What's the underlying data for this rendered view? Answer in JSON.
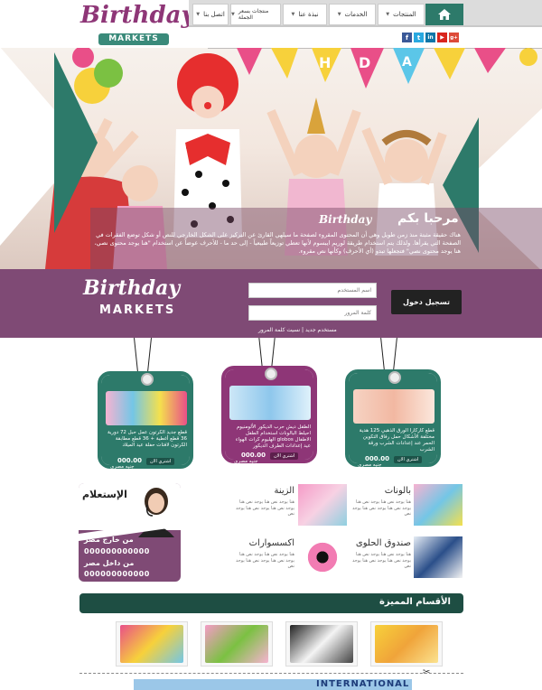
{
  "header": {
    "logo_line1": "Birthday",
    "logo_line2": "MARKETS"
  },
  "nav": {
    "items": [
      "المنتجات",
      "الخدمات",
      "نبذة عنا",
      "منتجات بسعر الجملة",
      "اتصل بنا"
    ]
  },
  "social": [
    "f",
    "t",
    "in",
    "▶",
    "g+"
  ],
  "hero": {
    "welcome_title": "مرحبا بكم",
    "welcome_logo": "Birthday",
    "welcome_text": "هناك حقيقة مثبتة منذ زمن طويل وهي أن المحتوى المقروء لصفحة ما سيلهي القارئ عن التركيز على الشكل الخارجي للنص أو شكل توضع الفقرات في الصفحة التي يقرأها. ولذلك يتم استخدام طريقة لوريم ايبسوم لأنها تعطي توزيعاً طبيعياً - إلى حد ما - للأحرف عوضاً عن استخدام \"هنا يوجد محتوى نصي، هنا يوجد محتوى نصي\" فتجعلها تبدو (أي الأحرف) وكأنها نص مقروء."
  },
  "login": {
    "logo_line1": "Birthday",
    "logo_line2": "MARKETS",
    "username_placeholder": "اسم المستخدم",
    "password_placeholder": "كلمة المرور",
    "button": "تسجيل دخول",
    "links": "مستخدم جديد | نسيت كلمة المرور"
  },
  "tags": [
    {
      "desc": "قطع كاركارا الورق الذهبي 125 هدية مختلفة الأشكال حمل رفاق التكوين الحمر عند إعدادات الشرب ورقة الشرب",
      "price": "000.00",
      "currency": "جنيه مصري",
      "button": "اشتري الان",
      "color": "#2d7a6a"
    },
    {
      "desc": "الطقل ديش حرب الديكور الألومنيوم احيلط البالونات استخدام الطفل الاطفال globos الهليوم كرات الهواء عيد إعدادات الطرف الديكور",
      "price": "000.00",
      "currency": "جنيه مصري",
      "button": "اشتري الان",
      "color": "#8e3677"
    },
    {
      "desc": "قطع جديد الكرتون عمل حبل 72 دورية 36 قطع أغطية + 36 قطع مطابقة الكرتون لافتات حفلة عيد الميلاد",
      "price": "000.00",
      "currency": "جنيه مصري",
      "button": "اشتري الان",
      "color": "#2d7a6a"
    }
  ],
  "categories": [
    {
      "title": "بالونات",
      "text": "هنا يوجد نص هنا يوجد نص هنا يوجد نص هنا يوجد نص هنا يوجد نص"
    },
    {
      "title": "الزينة",
      "text": "هنا يوجد نص هنا يوجد نص هنا يوجد نص هنا يوجد نص هنا يوجد نص"
    },
    {
      "title": "صندوق الحلوى",
      "text": "هنا يوجد نص هنا يوجد نص هنا يوجد نص هنا يوجد نص هنا يوجد نص"
    },
    {
      "title": "اكسسوارات",
      "text": "هنا يوجد نص هنا يوجد نص هنا يوجد نص هنا يوجد نص هنا يوجد نص"
    }
  ],
  "support": {
    "title": "الإستعلام",
    "line1": "من خارج مصر",
    "phone1": "000000000000",
    "line2": "من داخل مصر",
    "phone2": "000000000000"
  },
  "featured": {
    "title": "الأقسام المميزة"
  },
  "footer_banner": "INTERNATIONAL",
  "colors": {
    "teal": "#2d7a6a",
    "purple": "#7f4a75",
    "magenta": "#8e3677",
    "dark_green": "#1e4e43"
  }
}
